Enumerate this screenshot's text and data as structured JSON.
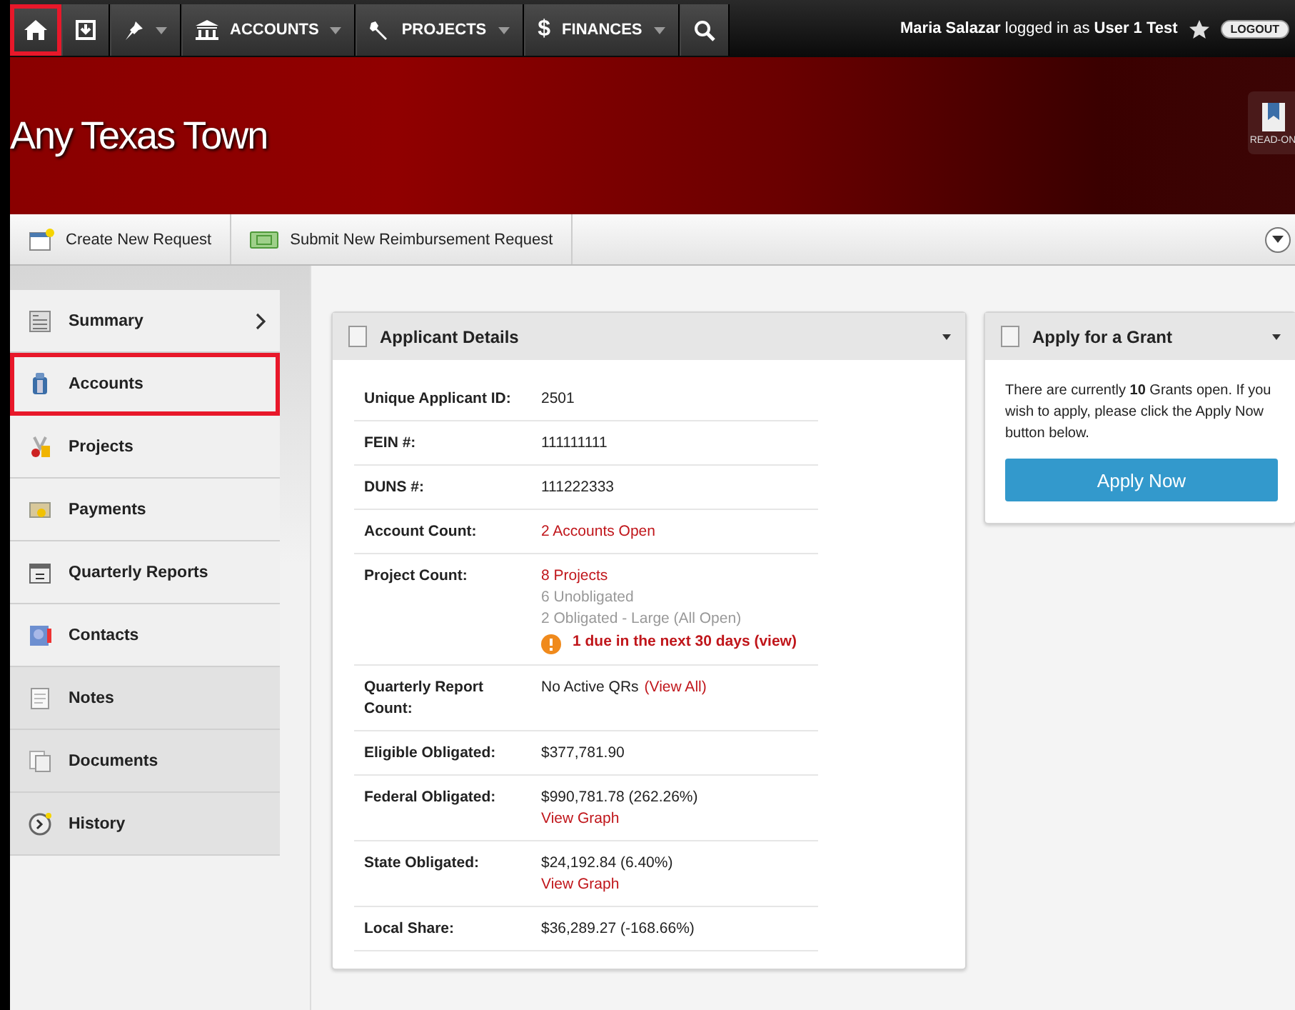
{
  "top_nav": {
    "items": [
      {
        "kind": "icon",
        "highlighted": true
      },
      {
        "kind": "icon",
        "highlighted": false
      },
      {
        "kind": "menu",
        "highlighted": false
      },
      {
        "kind": "menu",
        "label": "ACCOUNTS",
        "highlighted": false
      },
      {
        "kind": "menu",
        "label": "PROJECTS",
        "highlighted": false
      },
      {
        "kind": "menu",
        "glyph": "$",
        "label": "FINANCES",
        "highlighted": false
      },
      {
        "kind": "icon",
        "highlighted": false
      }
    ],
    "user_text": "**Maria Salazar** logged in as **User 1 Test**",
    "logout": "LOGOUT"
  },
  "banner": {
    "title": "Any Texas Town",
    "side_tab": "READ-ON"
  },
  "toolbar": {
    "buttons": [
      {
        "label": "Create New Request"
      },
      {
        "label": "Submit New Reimbursement Request"
      }
    ]
  },
  "sidebar": {
    "items": [
      {
        "label": "Summary",
        "chevron": true,
        "kind": "primary",
        "highlighted": false
      },
      {
        "label": "Accounts",
        "chevron": false,
        "kind": "primary",
        "highlighted": true
      },
      {
        "label": "Projects",
        "chevron": false,
        "kind": "primary",
        "highlighted": false
      },
      {
        "label": "Payments",
        "chevron": false,
        "kind": "primary",
        "highlighted": false
      },
      {
        "label": "Quarterly Reports",
        "chevron": false,
        "kind": "primary",
        "highlighted": false
      },
      {
        "label": "Contacts",
        "chevron": false,
        "kind": "primary",
        "highlighted": false
      },
      {
        "label": "Notes",
        "chevron": false,
        "kind": "secondary",
        "highlighted": false
      },
      {
        "label": "Documents",
        "chevron": false,
        "kind": "secondary",
        "highlighted": false
      },
      {
        "label": "History",
        "chevron": false,
        "kind": "secondary",
        "highlighted": false
      }
    ]
  },
  "applicant_details": {
    "title": "Applicant Details",
    "rows": [
      {
        "label": "Unique Applicant ID:",
        "lines": [
          [
            {
              "text": "2501",
              "kind": "plain"
            }
          ]
        ]
      },
      {
        "label": "FEIN #:",
        "lines": [
          [
            {
              "text": "111111111",
              "kind": "plain"
            }
          ]
        ]
      },
      {
        "label": "DUNS #:",
        "lines": [
          [
            {
              "text": "111222333",
              "kind": "plain"
            }
          ]
        ]
      },
      {
        "label": "Account Count:",
        "lines": [
          [
            {
              "text": "2 Accounts Open",
              "kind": "link"
            }
          ]
        ]
      },
      {
        "label": "Project Count:",
        "lines": [
          [
            {
              "text": "8 Projects",
              "kind": "link"
            }
          ],
          [
            {
              "text": "6 Unobligated",
              "kind": "muted"
            }
          ],
          [
            {
              "text": "2 Obligated - Large (All Open)",
              "kind": "muted"
            }
          ],
          [
            {
              "text": "1 due in the next 30 days (view)",
              "kind": "alert"
            }
          ]
        ]
      },
      {
        "label": "Quarterly Report Count:",
        "lines": [
          [
            {
              "text": "No Active QRs",
              "kind": "plain"
            },
            {
              "text": "(View All)",
              "kind": "link"
            }
          ]
        ]
      },
      {
        "label": "Eligible Obligated:",
        "lines": [
          [
            {
              "text": "$377,781.90",
              "kind": "plain"
            }
          ]
        ]
      },
      {
        "label": "Federal Obligated:",
        "lines": [
          [
            {
              "text": "$990,781.78 (262.26%)",
              "kind": "plain"
            }
          ],
          [
            {
              "text": "View Graph",
              "kind": "link"
            }
          ]
        ]
      },
      {
        "label": "State Obligated:",
        "lines": [
          [
            {
              "text": "$24,192.84 (6.40%)",
              "kind": "plain"
            }
          ],
          [
            {
              "text": "View Graph",
              "kind": "link"
            }
          ]
        ]
      },
      {
        "label": "Local Share:",
        "lines": [
          [
            {
              "text": "$36,289.27 (-168.66%)",
              "kind": "plain"
            }
          ]
        ]
      }
    ]
  },
  "grant_panel": {
    "title": "Apply for a Grant",
    "message": "There are currently **10** Grants open. If you wish to apply, please click the Apply Now button below.",
    "button": "Apply Now"
  }
}
